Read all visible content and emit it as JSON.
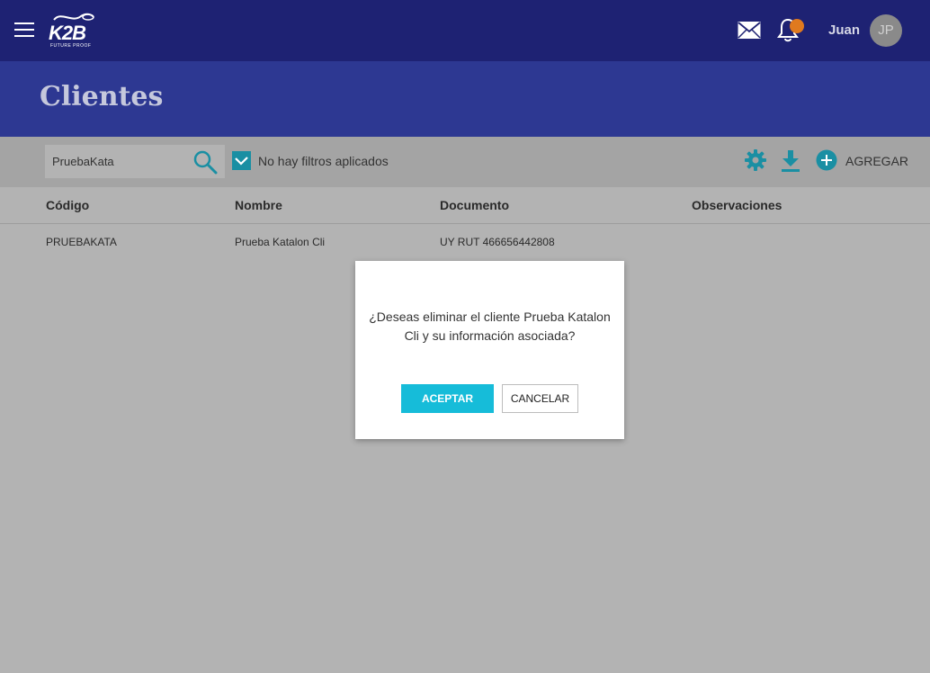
{
  "header": {
    "logo_text": "K2B",
    "logo_tagline": "FUTURE PROOF",
    "user_name": "Juan",
    "user_initials": "JP"
  },
  "page": {
    "title": "Clientes"
  },
  "toolbar": {
    "search_value": "PruebaKata",
    "filter_label": "No hay filtros aplicados",
    "add_label": "AGREGAR"
  },
  "table": {
    "columns": [
      "Código",
      "Nombre",
      "Documento",
      "Observaciones"
    ],
    "rows": [
      [
        "PRUEBAKATA",
        "Prueba Katalon Cli",
        "UY RUT 466656442808",
        ""
      ]
    ]
  },
  "dialog": {
    "message": "¿Deseas eliminar el cliente Prueba Katalon Cli y su información asociada?",
    "accept_label": "ACEPTAR",
    "cancel_label": "CANCELAR"
  },
  "colors": {
    "header_bg": "#1e2273",
    "title_band_bg": "#2d3892",
    "accent_teal": "#1a8fa3",
    "accept_button": "#16bcd9",
    "notification_badge": "#e07a1f"
  }
}
